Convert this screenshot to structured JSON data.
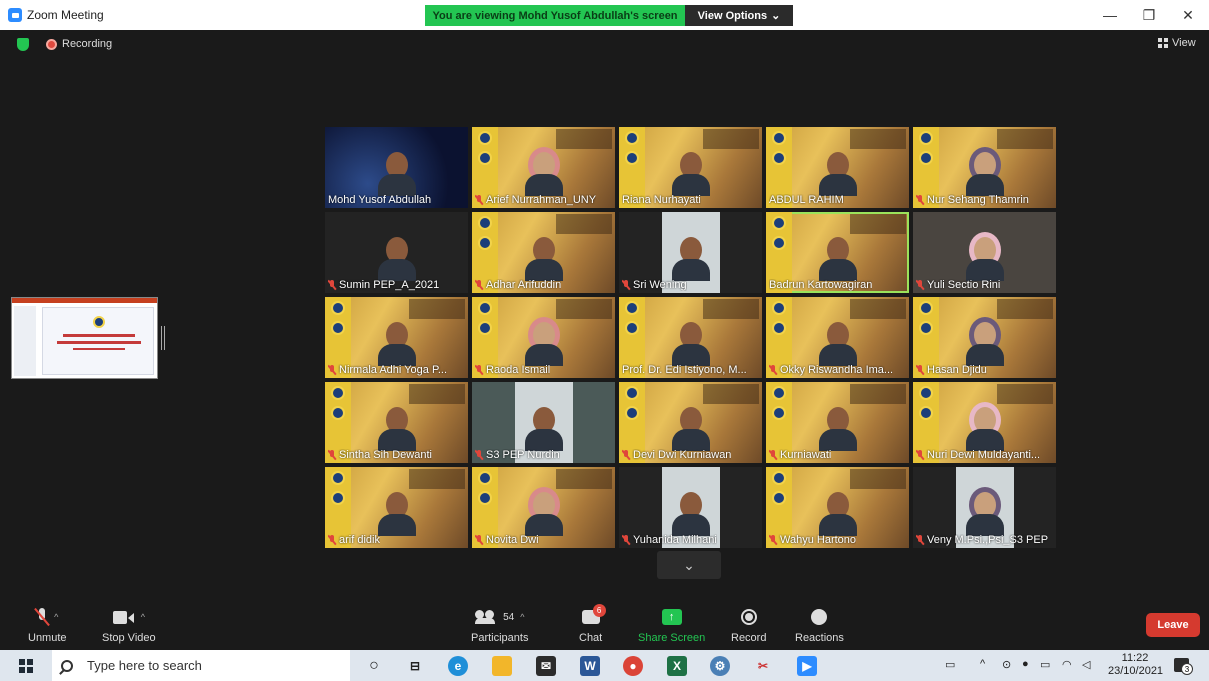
{
  "window": {
    "title": "Zoom Meeting"
  },
  "share": {
    "banner": "You are viewing Mohd Yusof Abdullah's screen",
    "view_options": "View Options"
  },
  "meeting": {
    "recording_label": "Recording",
    "view_label": "View"
  },
  "participants": [
    {
      "name": "Mohd Yusof Abdullah",
      "muted": false,
      "bg": "space"
    },
    {
      "name": "Arief Nurrahman_UNY",
      "muted": true,
      "bg": "poster"
    },
    {
      "name": "Riana Nurhayati",
      "muted": false,
      "bg": "poster"
    },
    {
      "name": "ABDUL RAHIM",
      "muted": false,
      "bg": "poster"
    },
    {
      "name": "Nur Sehang Thamrin",
      "muted": true,
      "bg": "poster"
    },
    {
      "name": "Sumin PEP_A_2021",
      "muted": true,
      "bg": "dark"
    },
    {
      "name": "Adhar Arifuddin",
      "muted": true,
      "bg": "poster"
    },
    {
      "name": "Sri Wening",
      "muted": true,
      "bg": "inset"
    },
    {
      "name": "Badrun Kartowagiran",
      "muted": false,
      "bg": "poster",
      "speaking": true
    },
    {
      "name": "Yuli Sectio Rini",
      "muted": true,
      "bg": "room"
    },
    {
      "name": "Nirmala Adhi Yoga P...",
      "muted": true,
      "bg": "poster"
    },
    {
      "name": "Raoda Ismail",
      "muted": true,
      "bg": "poster"
    },
    {
      "name": "Prof. Dr. Edi Istiyono, M...",
      "muted": false,
      "bg": "poster"
    },
    {
      "name": "Okky Riswandha Ima...",
      "muted": true,
      "bg": "poster"
    },
    {
      "name": "Hasan Djidu",
      "muted": true,
      "bg": "poster"
    },
    {
      "name": "Sintha Sih Dewanti",
      "muted": true,
      "bg": "poster"
    },
    {
      "name": "S3 PEP Nurdin",
      "muted": true,
      "bg": "car"
    },
    {
      "name": "Devi Dwi Kurniawan",
      "muted": true,
      "bg": "poster"
    },
    {
      "name": "Kurniawati",
      "muted": true,
      "bg": "poster"
    },
    {
      "name": "Nuri Dewi Muldayanti...",
      "muted": true,
      "bg": "poster"
    },
    {
      "name": "arif didik",
      "muted": true,
      "bg": "poster"
    },
    {
      "name": "Novita Dwi",
      "muted": true,
      "bg": "poster"
    },
    {
      "name": "Yuhanida Milhani",
      "muted": true,
      "bg": "inset"
    },
    {
      "name": "Wahyu Hartono",
      "muted": true,
      "bg": "poster"
    },
    {
      "name": "Veny M.Psi.,Psi_S3 PEP",
      "muted": true,
      "bg": "inset"
    }
  ],
  "toolbar": {
    "unmute": "Unmute",
    "stop_video": "Stop Video",
    "participants": "Participants",
    "participants_count": "54",
    "chat": "Chat",
    "chat_badge": "6",
    "share_screen": "Share Screen",
    "record": "Record",
    "reactions": "Reactions",
    "leave": "Leave"
  },
  "taskbar": {
    "search_placeholder": "Type here to search",
    "time": "11:22",
    "date": "23/10/2021",
    "notification_count": "3"
  },
  "colors": {
    "share_green": "#23c552",
    "leave_red": "#d53a2f",
    "meeting_bg": "#1a1a1a",
    "muted_red": "#e0463b"
  }
}
